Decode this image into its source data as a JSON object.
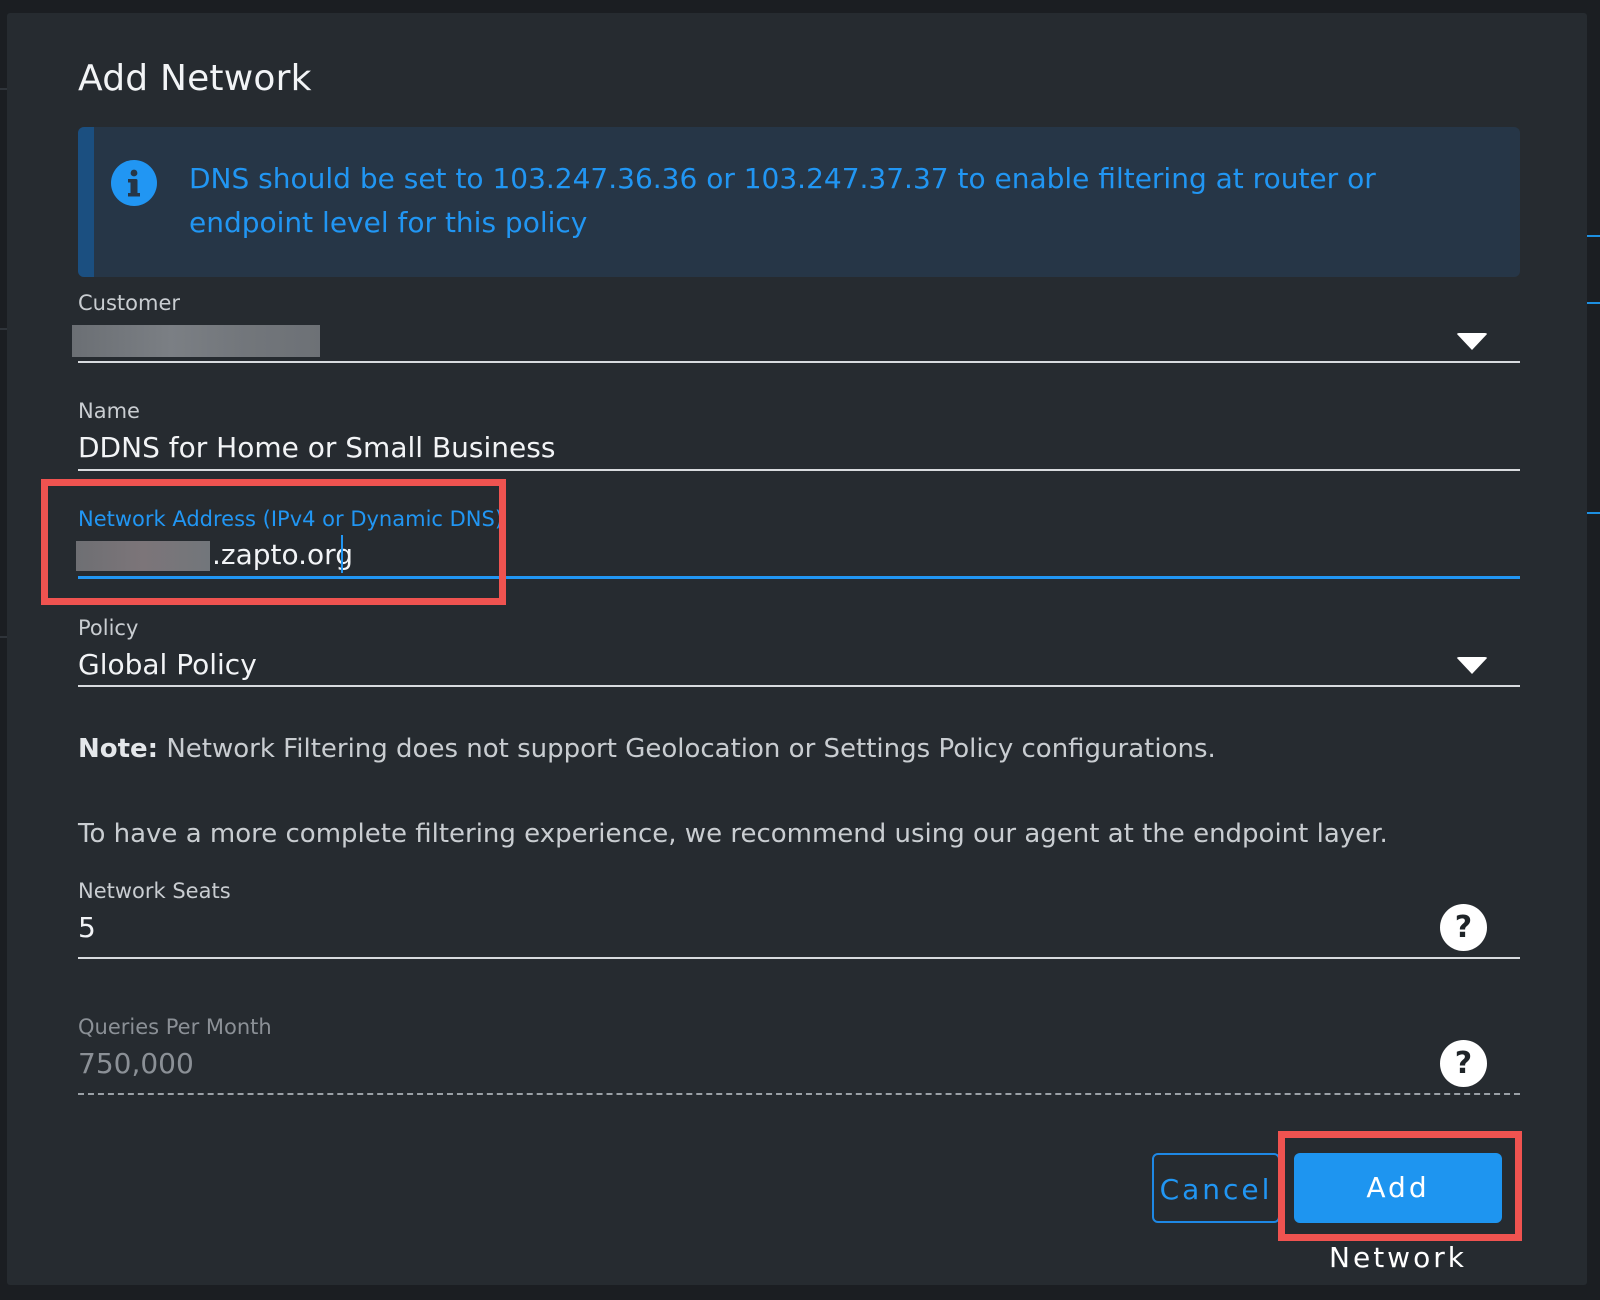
{
  "dialog": {
    "title": "Add Network",
    "info": {
      "icon": "info-icon",
      "text": "DNS should be set to 103.247.36.36 or 103.247.37.37 to enable filtering at router or endpoint level for this policy"
    },
    "customer": {
      "label": "Customer",
      "value_redacted": true
    },
    "name": {
      "label": "Name",
      "value": "DDNS for Home or Small Business"
    },
    "network_address": {
      "label": "Network Address (IPv4 or Dynamic DNS)",
      "value_suffix": ".zapto.org",
      "value_redacted_prefix": true
    },
    "policy": {
      "label": "Policy",
      "value": "Global Policy"
    },
    "note": {
      "prefix": "Note:",
      "text": "Network Filtering does not support Geolocation or Settings Policy configurations."
    },
    "recommendation": "To have a more complete filtering experience, we recommend using our agent at the endpoint layer.",
    "network_seats": {
      "label": "Network Seats",
      "value": "5"
    },
    "queries_per_month": {
      "label": "Queries Per Month",
      "value": "750,000"
    },
    "buttons": {
      "cancel": "Cancel",
      "submit": "Add Network"
    }
  },
  "colors": {
    "accent": "#2196f3",
    "highlight": "#ef5350",
    "dialog_bg": "#262b30"
  }
}
